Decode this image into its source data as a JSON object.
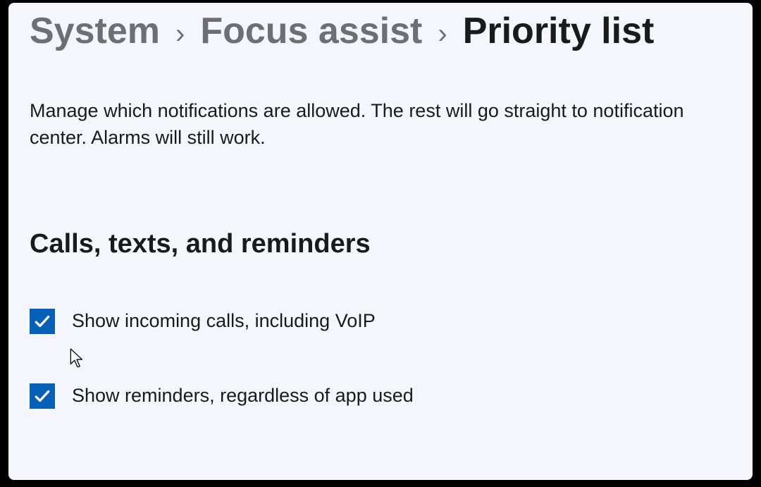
{
  "breadcrumb": {
    "items": [
      {
        "label": "System",
        "current": false
      },
      {
        "label": "Focus assist",
        "current": false
      },
      {
        "label": "Priority list",
        "current": true
      }
    ],
    "separator": "›"
  },
  "description": "Manage which notifications are allowed. The rest will go straight to notification center. Alarms will still work.",
  "section": {
    "heading": "Calls, texts, and reminders",
    "options": [
      {
        "label": "Show incoming calls, including VoIP",
        "checked": true
      },
      {
        "label": "Show reminders, regardless of app used",
        "checked": true
      }
    ]
  },
  "colors": {
    "accent": "#0760b8",
    "background": "#f4f6fb",
    "textPrimary": "#1a1a1a",
    "textSecondary": "#6f6f73"
  }
}
